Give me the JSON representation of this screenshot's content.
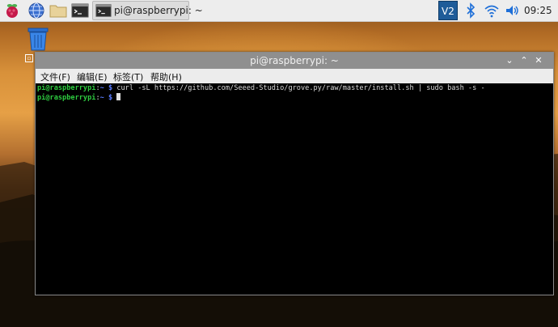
{
  "taskbar": {
    "icons": [
      "raspberry-icon",
      "globe-icon",
      "folder-icon",
      "terminal-icon"
    ],
    "active_task_label": "pi@raspberrypi: ~",
    "tray": [
      "vnc-icon",
      "bluetooth-icon",
      "wifi-icon",
      "volume-icon"
    ],
    "clock": "09:25"
  },
  "desktop": {
    "trash_icon": "trash-icon"
  },
  "window": {
    "title": "pi@raspberrypi: ~",
    "buttons": [
      "minimize",
      "maximize",
      "close"
    ],
    "menu": [
      "文件(F)",
      "编辑(E)",
      "标签(T)",
      "帮助(H)"
    ]
  },
  "terminal": {
    "lines": [
      {
        "user": "pi@raspberrypi",
        "sep": ":",
        "path": "~ $",
        "command": " curl -sL https://github.com/Seeed-Studio/grove.py/raw/master/install.sh | sudo bash -s -"
      },
      {
        "user": "pi@raspberrypi",
        "sep": ":",
        "path": "~ $",
        "command": " "
      }
    ]
  },
  "colors": {
    "taskbar_bg": "#ededed",
    "titlebar_bg": "#8f8f8f",
    "terminal_bg": "#000000",
    "prompt_user": "#2ecc40",
    "prompt_path": "#5a7cff"
  }
}
